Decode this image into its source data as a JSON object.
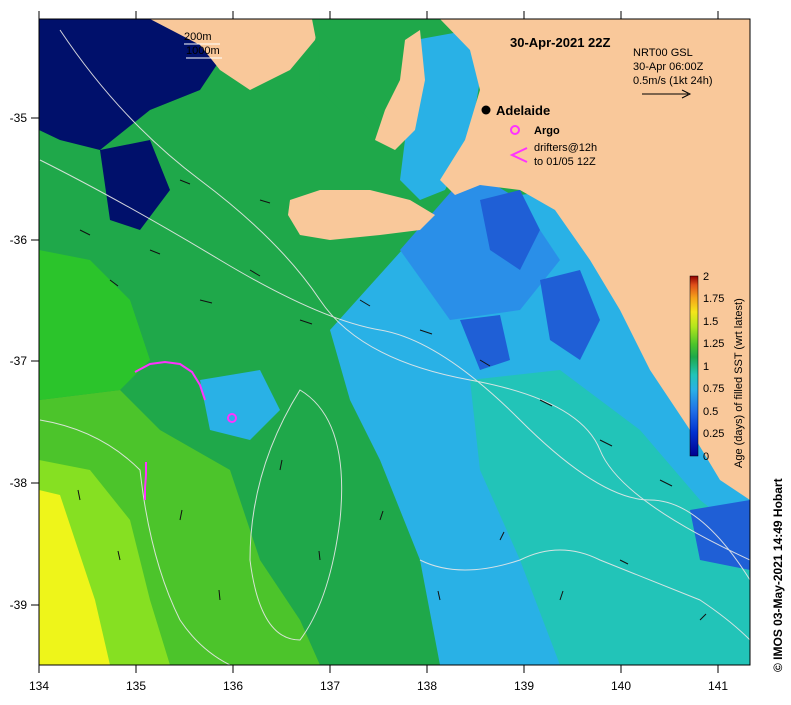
{
  "map": {
    "title": "30-Apr-2021 22Z",
    "contour_legend": [
      "200m",
      "1000m"
    ],
    "product": {
      "line1": "NRT00 GSL",
      "line2": "30-Apr 06:00Z",
      "line3": "0.5m/s (1kt 24h)"
    },
    "city": "Adelaide",
    "legend_argo": "Argo",
    "legend_drifters_line1": "drifters@12h",
    "legend_drifters_line2": "to 01/05 12Z",
    "x_ticks": [
      "134",
      "135",
      "136",
      "137",
      "138",
      "139",
      "140",
      "141"
    ],
    "y_ticks": [
      "-35",
      "-36",
      "-37",
      "-38",
      "-39"
    ],
    "colorbar": {
      "label": "Age (days) of filled SST (wrt latest)",
      "ticks": [
        "2",
        "1.75",
        "1.5",
        "1.25",
        "1",
        "0.75",
        "0.5",
        "0.25",
        "0"
      ]
    },
    "credit": "© IMOS 03-May-2021 14:49 Hobart",
    "colors": {
      "land": "#f9c89a",
      "dark_navy": "#00106b",
      "deep_blue": "#1f5fd6",
      "mid_blue": "#2a8fe8",
      "light_blue": "#29b1e6",
      "teal": "#22c4b8",
      "green": "#1fa84a",
      "bright_green": "#2bc42b",
      "lime": "#86e022",
      "yellow": "#eef51a",
      "argo": "#ff33ff"
    }
  }
}
